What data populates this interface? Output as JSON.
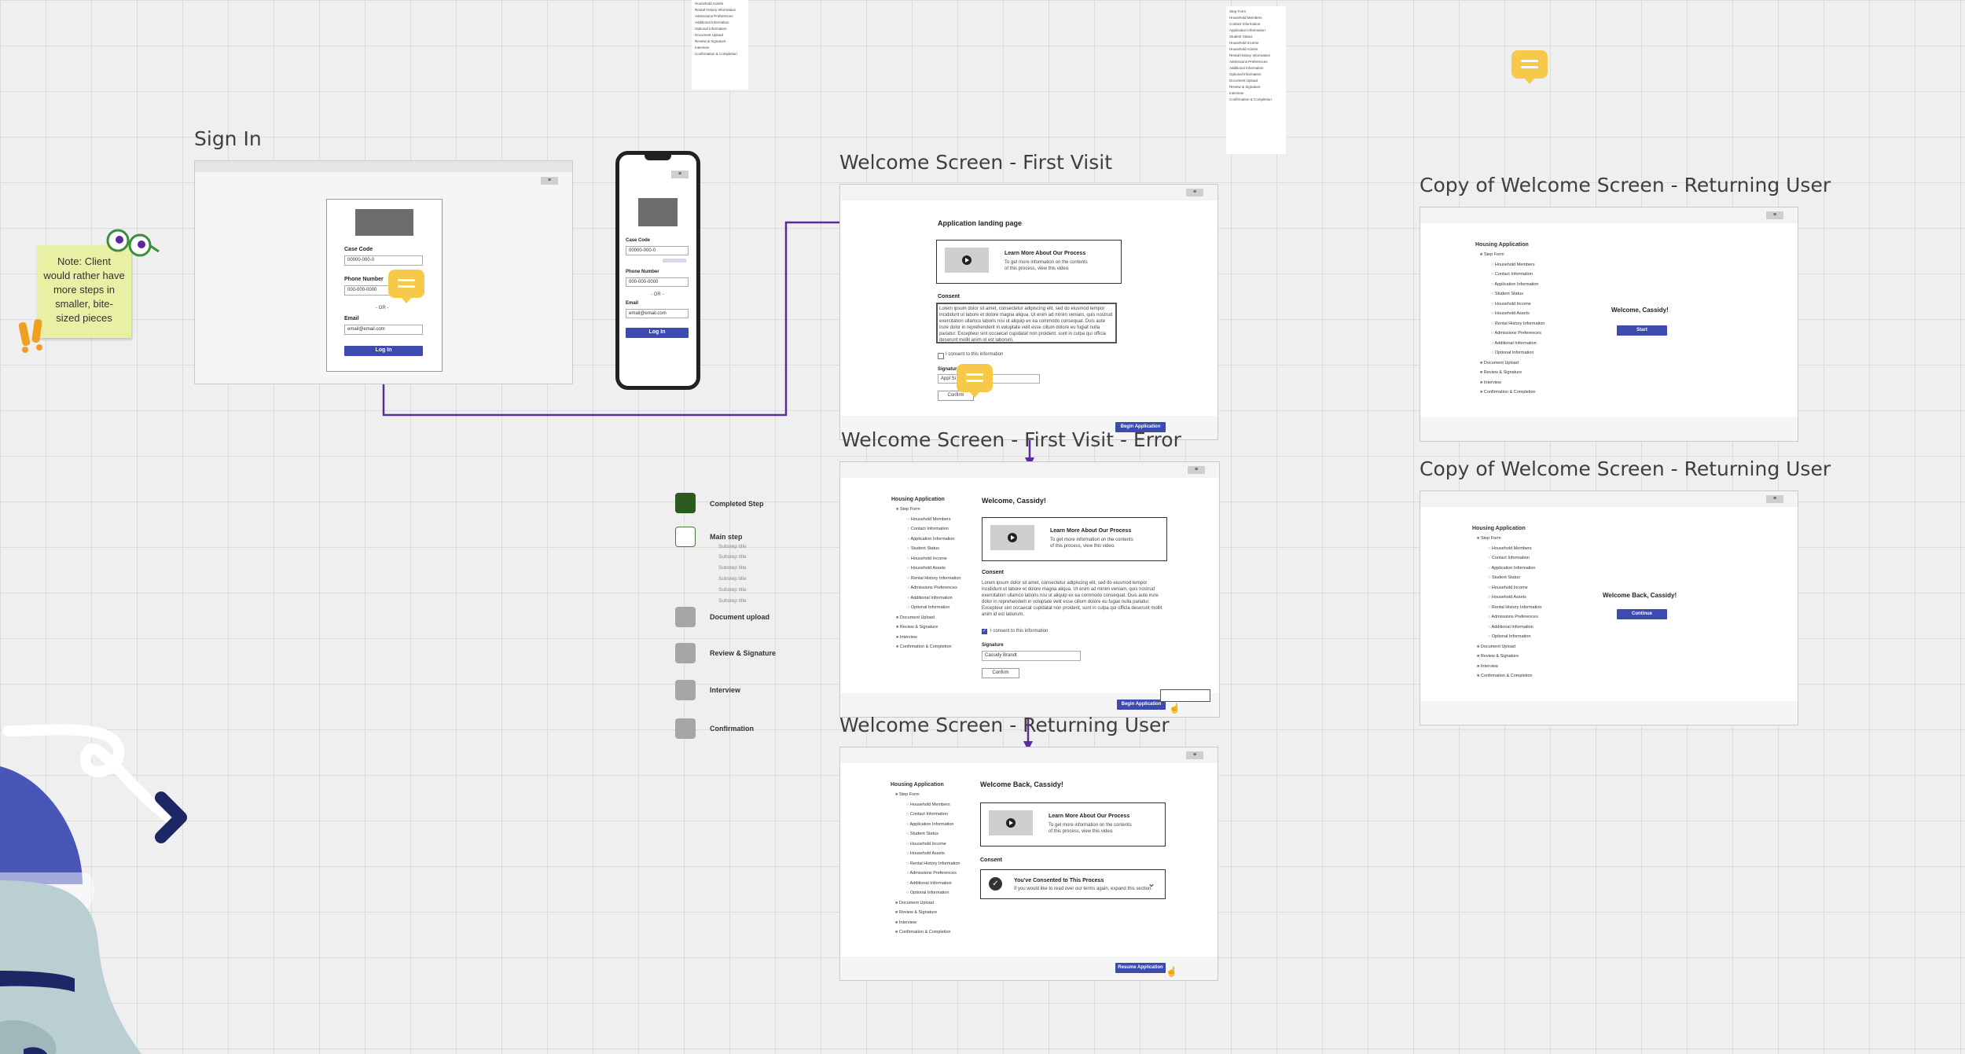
{
  "note": {
    "text": "Note: Client would rather have more steps in smaller, bite-sized pieces"
  },
  "signin": {
    "title": "Sign In",
    "case_code_label": "Case Code",
    "case_code_value": "00000-000-0",
    "phone_label": "Phone Number",
    "phone_value": "000-000-0000",
    "or_label": "- OR -",
    "email_label": "Email",
    "email_value": "email@email.com",
    "login_button": "Log In"
  },
  "mobile": {
    "case_code_label": "Case Code",
    "case_code_value": "00000-000-0",
    "phone_label": "Phone Number",
    "phone_value": "000-000-0000",
    "or_label": "- OR -",
    "email_label": "Email",
    "email_value": "email@email.com",
    "login_button": "Log In"
  },
  "welcome_first": {
    "title": "Welcome Screen - First Visit",
    "heading": "Application landing page",
    "video_title": "Learn More About Our Process",
    "video_desc": "To get more information on the contents of this process, view this video.",
    "consent_label": "Consent",
    "consent_text": "Lorem ipsum dolor sit amet, consectetur adipiscing elit, sed do eiusmod tempor incididunt ut labore et dolore magna aliqua. Ut enim ad minim veniam, quis nostrud exercitation ullamco laboris nisi ut aliquip ex ea commodo consequat. Duis aute irure dolor in reprehenderit in voluptate velit esse cillum dolore eu fugiat nulla pariatur. Excepteur sint occaecat cupidatat non proident, sunt in culpa qui officia deserunt mollit anim id est laborum.",
    "checkbox_label": "I consent to this information",
    "signature_label": "Signature",
    "signature_value": "Appl Si",
    "confirm_button": "Confirm",
    "begin_button": "Begin Application"
  },
  "welcome_error": {
    "title": "Welcome Screen - First Visit - Error",
    "greeting": "Welcome, Cassidy!",
    "video_title": "Learn More About Our Process",
    "video_desc": "To get more information on the contents of this process, view this video.",
    "consent_label": "Consent",
    "consent_text": "Lorem ipsum dolor sit amet, consectetur adipiscing elit, sed do eiusmod tempor incididunt ut labore et dolore magna aliqua. Ut enim ad minim veniam, quis nostrud exercitation ullamco laboris nisi ut aliquip ex ea commodo consequat. Duis aute irure dolor in reprehenderit in voluptate velit esse cillum dolore eu fugiat nulla pariatur. Excepteur sint occaecat cupidatat non proident, sunt in culpa qui officia deserunt mollit anim id est laborum.",
    "checkbox_label": "I consent to this information",
    "signature_label": "Signature",
    "signature_value": "Cassidy Brandt",
    "confirm_button": "Confirm",
    "begin_button": "Begin Application"
  },
  "welcome_returning": {
    "title": "Welcome Screen - Returning User",
    "greeting": "Welcome Back, Cassidy!",
    "video_title": "Learn More About Our Process",
    "video_desc": "To get more information on the contents of this process, view this video.",
    "consent_label": "Consent",
    "consented_title": "You've Consented to This Process",
    "consented_desc": "If you would like to read over our terms again, expand this section.",
    "resume_button": "Resume Application"
  },
  "copy1": {
    "title": "Copy of Welcome Screen - Returning User",
    "greeting": "Welcome, Cassidy!",
    "button": "Start"
  },
  "copy2": {
    "title": "Copy of Welcome Screen - Returning User",
    "greeting": "Welcome Back, Cassidy!",
    "button": "Continue"
  },
  "sidebar": {
    "heading": "Housing Application",
    "items": [
      {
        "label": "Step Form",
        "level": "main"
      },
      {
        "label": "Household Members",
        "level": "sub"
      },
      {
        "label": "Contact Information",
        "level": "sub"
      },
      {
        "label": "Application Information",
        "level": "sub"
      },
      {
        "label": "Student Status",
        "level": "sub"
      },
      {
        "label": "Household Income",
        "level": "sub"
      },
      {
        "label": "Household Assets",
        "level": "sub"
      },
      {
        "label": "Rental History Information",
        "level": "sub"
      },
      {
        "label": "Admissions Preferences",
        "level": "sub"
      },
      {
        "label": "Additional Information",
        "level": "sub"
      },
      {
        "label": "Optional Information",
        "level": "sub"
      },
      {
        "label": "Document Upload",
        "level": "main"
      },
      {
        "label": "Review & Signature",
        "level": "main"
      },
      {
        "label": "Interview",
        "level": "main"
      },
      {
        "label": "Confirmation & Completion",
        "level": "main"
      }
    ]
  },
  "legend": {
    "completed": "Completed Step",
    "main": "Main step",
    "subs": [
      "Substep title",
      "Substep title",
      "Substep title",
      "Substep title",
      "Substep title",
      "Substep title"
    ],
    "upload": "Document upload",
    "review": "Review & Signature",
    "interview": "Interview",
    "confirmation": "Confirmation"
  },
  "minilist_top": [
    "Household Assets",
    "Rental History Information",
    "Admissions Preferences",
    "Additional Information",
    "Optional Information",
    "Document Upload",
    "Review & Signature",
    "Interview",
    "Confirmation & Completion"
  ],
  "minilist_right": [
    "Step Form",
    "Household Members",
    "Contact Information",
    "Application Information",
    "Student Status",
    "Household Income",
    "Household Assets",
    "Rental History Information",
    "Admissions Preferences",
    "Additional Information",
    "Optional Information",
    "Document Upload",
    "Review & Signature",
    "Interview",
    "Confirmation & Completion"
  ],
  "colors": {
    "accent": "#3d4ab0",
    "connector": "#5b2a9e",
    "sticky": "#e8f0a4",
    "bubble": "#f7c948",
    "completed": "#2a5a1f"
  }
}
